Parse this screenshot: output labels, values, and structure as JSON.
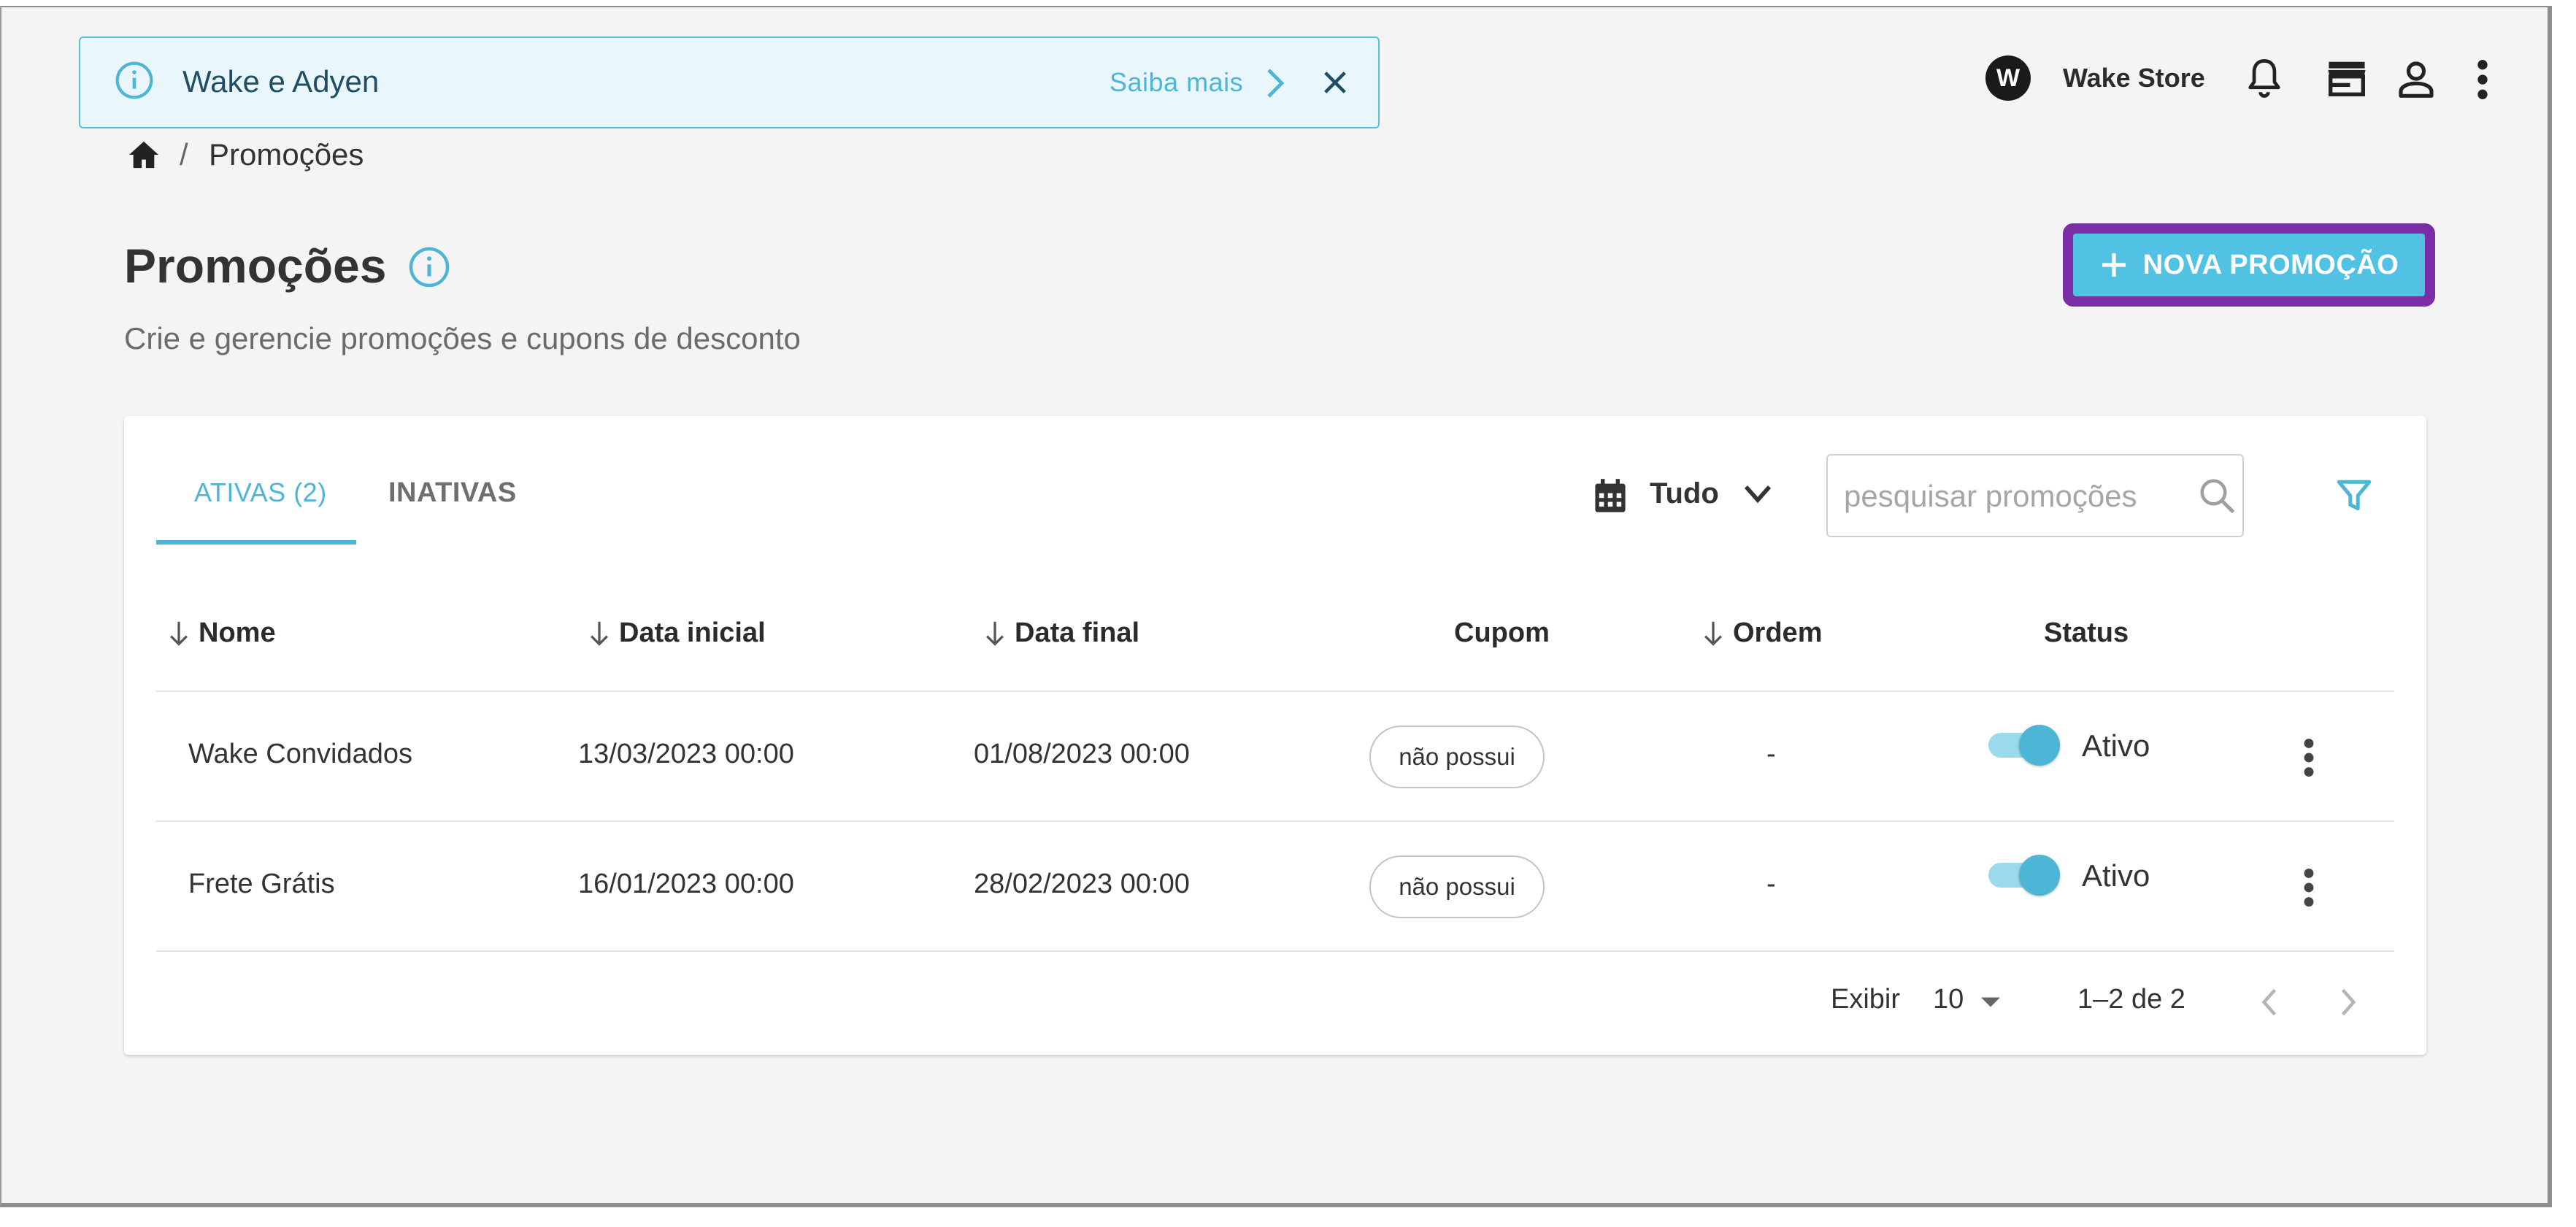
{
  "banner": {
    "title": "Wake e Adyen",
    "link": "Saiba mais"
  },
  "header": {
    "avatar_letter": "W",
    "store_name": "Wake Store"
  },
  "breadcrumb": {
    "current": "Promoções",
    "separator": "/"
  },
  "page": {
    "title": "Promoções",
    "subtitle": "Crie e gerencie promoções e cupons de desconto",
    "new_button": "NOVA PROMOÇÃO"
  },
  "tabs": [
    {
      "label": "ATIVAS (2)",
      "active": true
    },
    {
      "label": "INATIVAS",
      "active": false
    }
  ],
  "date_filter": {
    "value": "Tudo"
  },
  "search": {
    "placeholder": "pesquisar promoções",
    "value": ""
  },
  "table": {
    "columns": [
      "Nome",
      "Data inicial",
      "Data final",
      "Cupom",
      "Ordem",
      "Status"
    ],
    "rows": [
      {
        "nome": "Wake Convidados",
        "data_inicial": "13/03/2023 00:00",
        "data_final": "01/08/2023 00:00",
        "cupom": "não possui",
        "ordem": "-",
        "status": "Ativo"
      },
      {
        "nome": "Frete Grátis",
        "data_inicial": "16/01/2023 00:00",
        "data_final": "28/02/2023 00:00",
        "cupom": "não possui",
        "ordem": "-",
        "status": "Ativo"
      }
    ]
  },
  "pagination": {
    "label": "Exibir",
    "per_page": "10",
    "range": "1–2 de 2"
  },
  "colors": {
    "accent": "#4db6d6",
    "highlight": "#7b2da5"
  }
}
